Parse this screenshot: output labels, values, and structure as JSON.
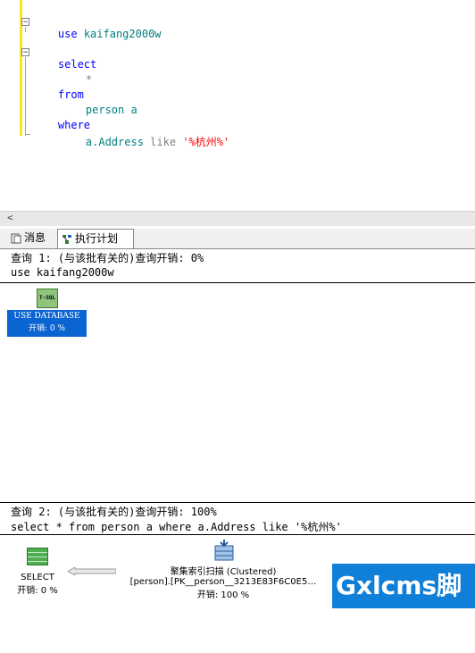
{
  "editor": {
    "lines": {
      "l1_kw": "use",
      "l1_db": "kaifang2000w",
      "l2_kw": "select",
      "l3_star": "*",
      "l4_kw": "from",
      "l5_table": "person a",
      "l6_kw": "where",
      "l7_col": "a.Address",
      "l7_op": "like",
      "l7_str": "'%杭州%'"
    }
  },
  "scrollbar": {
    "left_arrow": "<"
  },
  "tabs": {
    "messages": "消息",
    "execution_plan": "执行计划"
  },
  "query1": {
    "header": "查询 1: (与该批有关的)查询开销: 0%",
    "sql": "use kaifang2000w",
    "tsql_icon_label": "T-SQL",
    "op_title": "USE DATABASE",
    "op_cost": "开销: 0 %"
  },
  "query2": {
    "header": "查询 2: (与该批有关的)查询开销: 100%",
    "sql": "select * from person a where a.Address like '%杭州%'",
    "select_title": "SELECT",
    "select_cost": "开销: 0 %",
    "scan_title": "聚集索引扫描 (Clustered)",
    "scan_object": "[person].[PK__person__3213E83F6C0E5…",
    "scan_cost": "开销: 100 %"
  },
  "watermark": "Gxlcms脚本",
  "colors": {
    "keyword": "#0000ff",
    "identifier": "#008080",
    "string": "#ff0000",
    "selected_operator": "#0a64d2"
  }
}
